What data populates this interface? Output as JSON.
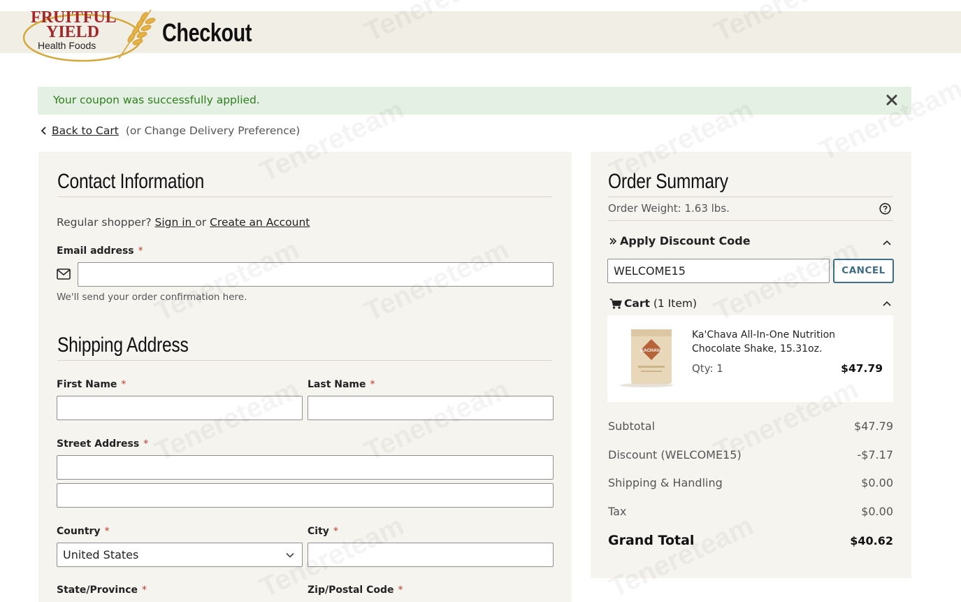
{
  "header": {
    "logo": {
      "line1": "FRUITFUL",
      "line2": "YIELD",
      "line3": "Health Foods"
    },
    "title": "Checkout"
  },
  "alert": {
    "message": "Your coupon was successfully applied.",
    "close_icon": "close-icon"
  },
  "nav": {
    "back_label": "Back to Cart",
    "note": "(or Change Delivery Preference)"
  },
  "contact": {
    "title": "Contact Information",
    "prompt": "Regular shopper?",
    "sign_in": "Sign in ",
    "or": "or",
    "create_account": "Create an Account",
    "email_label": "Email address",
    "email_value": "",
    "email_hint": "We'll send your order confirmation here."
  },
  "shipping": {
    "title": "Shipping Address",
    "first_name_label": "First Name",
    "last_name_label": "Last Name",
    "street_label": "Street Address",
    "country_label": "Country",
    "country_value": "United States",
    "city_label": "City",
    "state_label": "State/Province",
    "zip_label": "Zip/Postal Code",
    "required_mark": "*"
  },
  "summary": {
    "title": "Order Summary",
    "weight": "Order Weight: 1.63 lbs.",
    "discount_title": "Apply Discount Code",
    "discount_value": "WELCOME15",
    "cancel_label": "CANCEL",
    "cart_label": "Cart",
    "cart_count": "(1 Item)",
    "item": {
      "name": "Ka'Chava All-In-One Nutrition Chocolate Shake, 15.31oz.",
      "qty": "Qty: 1",
      "price": "$47.79",
      "image_text": "KACHAVA"
    },
    "rows": {
      "subtotal_label": "Subtotal",
      "subtotal_value": "$47.79",
      "discount_label": "Discount (WELCOME15)",
      "discount_value": "-$7.17",
      "shipping_label": "Shipping & Handling",
      "shipping_value": "$0.00",
      "tax_label": "Tax",
      "tax_value": "$0.00"
    },
    "grand_label": "Grand Total",
    "grand_value": "$40.62"
  },
  "watermark": "Tenereteam",
  "colors": {
    "header_band": "#f1eee5",
    "panel_bg": "#f6f4ef",
    "success_bg": "#e3f0e3",
    "success_text": "#2e7d1c",
    "accent_button": "#3d6e87",
    "required": "#c0392b"
  }
}
